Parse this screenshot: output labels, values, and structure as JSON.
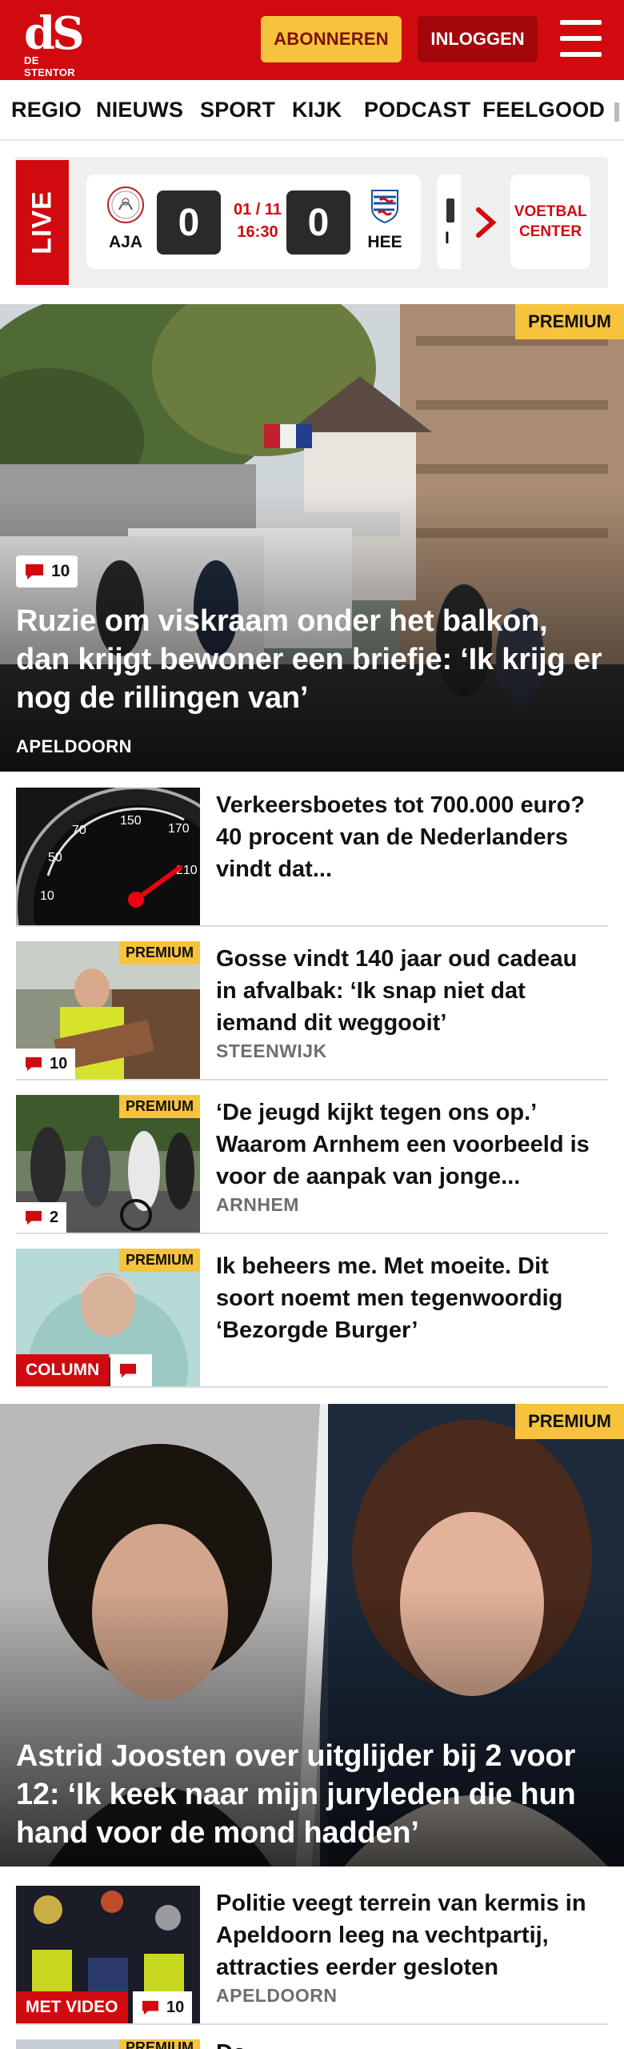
{
  "header": {
    "logo_mark": "dS",
    "logo_sub": "DE STENTOR",
    "subscribe_label": "ABONNEREN",
    "login_label": "INLOGGEN",
    "brand_color": "#d10a10"
  },
  "nav": {
    "items": [
      "REGIO",
      "NIEUWS",
      "SPORT",
      "KIJK",
      "PODCAST",
      "FEELGOOD"
    ]
  },
  "live": {
    "label": "LIVE",
    "match": {
      "home": "AJA",
      "away": "HEE",
      "home_score": "0",
      "away_score": "0",
      "date": "01 / 11",
      "time": "16:30"
    },
    "next_partial_team": "I",
    "voetbal_center": "VOETBAL CENTER"
  },
  "hero1": {
    "premium": "PREMIUM",
    "comments": "10",
    "title": "Ruzie om viskraam onder het balkon, dan krijgt bewoner een briefje: ‘Ik krijg er nog de rillingen van’",
    "location": "APELDOORN"
  },
  "articles": [
    {
      "title": "Verkeersboetes tot 700.000 euro? 40 procent van de Nederlanders vindt dat...",
      "location": "",
      "premium": "",
      "comments": ""
    },
    {
      "title": "Gosse vindt 140 jaar oud cadeau in afvalbak: ‘Ik snap niet dat iemand dit weggooit’",
      "location": "STEENWIJK",
      "premium": "PREMIUM",
      "comments": "10"
    },
    {
      "title": "‘De jeugd kijkt tegen ons op.’ Waarom Arnhem een voorbeeld is voor de aanpak van jonge...",
      "location": "ARNHEM",
      "premium": "PREMIUM",
      "comments": "2"
    },
    {
      "title": "Ik beheers me. Met moeite. Dit soort noemt men tegenwoordig ‘Bezorgde Burger’",
      "location": "",
      "premium": "PREMIUM",
      "label": "COLUMN",
      "comments": ""
    }
  ],
  "hero2": {
    "premium": "PREMIUM",
    "title": "Astrid Joosten over uitglijder bij 2 voor 12: ‘Ik keek naar mijn juryleden die hun hand voor de mond hadden’"
  },
  "article5": {
    "title": "Politie veegt terrein van kermis in Apeldoorn leeg na vechtpartij, attracties eerder gesloten",
    "location": "APELDOORN",
    "label": "MET VIDEO",
    "comments": "10"
  },
  "article6": {
    "title": "De ",
    "premium": "PREMIUM"
  }
}
